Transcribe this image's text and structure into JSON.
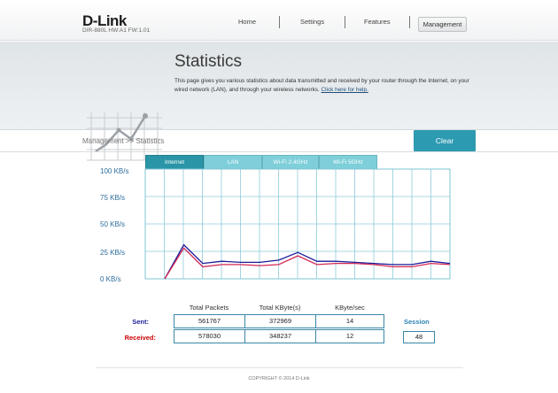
{
  "header": {
    "logo": "D-Link",
    "model": "DIR-880L   HW:A1   FW:1.01",
    "nav": [
      "Home",
      "Settings",
      "Features",
      "Management"
    ],
    "active_nav": "Management"
  },
  "hero": {
    "title": "Statistics",
    "description": "This page gives you various statistics about data transmitted and received by your router through the Internet, on your wired network (LAN), and through your wireless networks. ",
    "help_link": "Click here for help."
  },
  "breadcrumb": "Management >> Statistics",
  "clear_label": "Clear",
  "tabs": [
    "Internet",
    "LAN",
    "Wi-Fi 2.4GHz",
    "Wi-Fi 5GHz"
  ],
  "active_tab": "Internet",
  "chart_data": {
    "type": "line",
    "ylim": [
      0,
      100
    ],
    "y_ticks": [
      "100 KB/s",
      "75 KB/s",
      "50 KB/s",
      "25 KB/s",
      "0 KB/s"
    ],
    "series": [
      {
        "color": "#1c1c9a",
        "values": [
          0,
          31,
          14,
          16,
          15,
          15,
          17,
          24,
          16,
          16,
          15,
          14,
          13,
          13,
          16,
          14
        ]
      },
      {
        "color": "#d42a55",
        "values": [
          0,
          28,
          11,
          13,
          13,
          12,
          13,
          21,
          13,
          14,
          14,
          13,
          11,
          11,
          14,
          13
        ]
      }
    ]
  },
  "stats": {
    "headers": [
      "Total Packets",
      "Total KByte(s)",
      "KByte/sec"
    ],
    "sent_label": "Sent:",
    "received_label": "Received:",
    "sent": [
      "561767",
      "372969",
      "14"
    ],
    "received": [
      "578030",
      "348237",
      "12"
    ],
    "session_label": "Session",
    "session_value": "48"
  },
  "colors": {
    "accent": "#2c9ab1",
    "sent": "#1c1c9a",
    "received": "#cc0000"
  },
  "footer": "COPYRIGHT © 2014 D-Link"
}
